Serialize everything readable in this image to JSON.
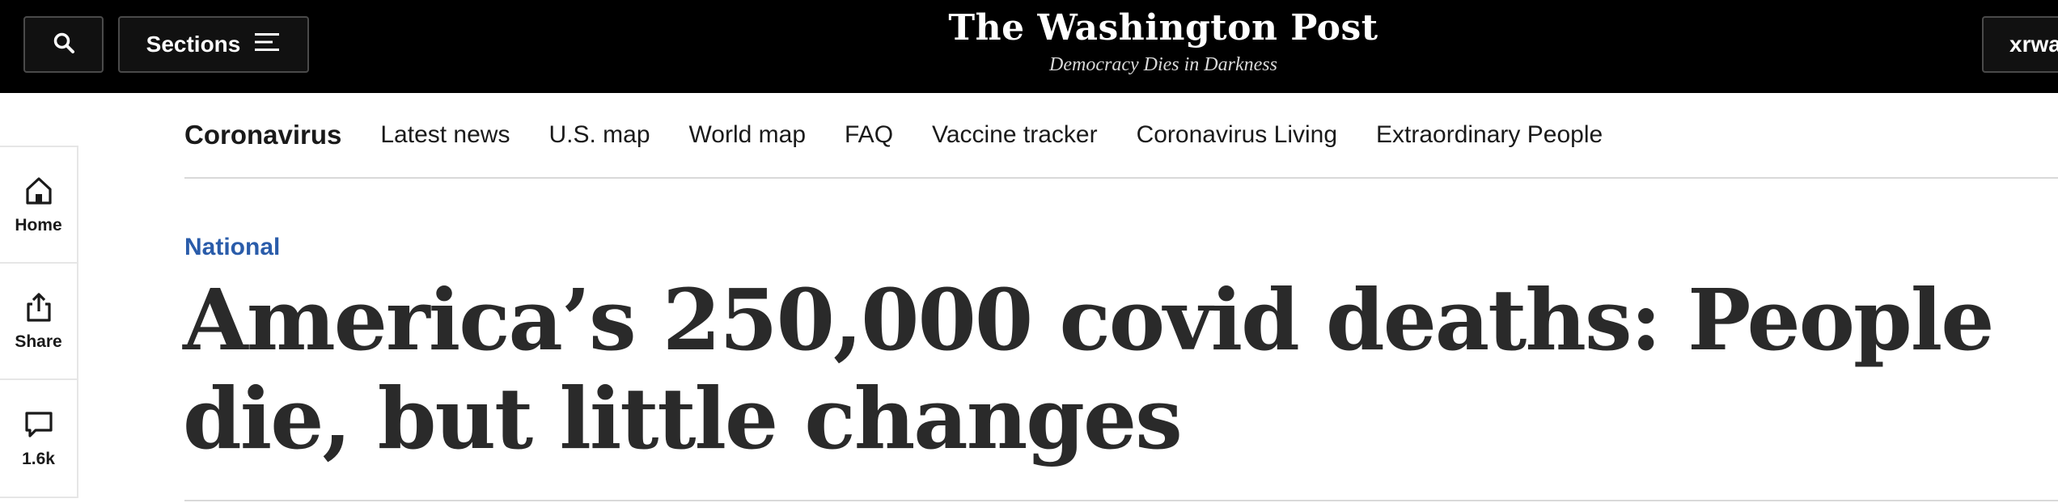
{
  "header": {
    "search_icon": "search-icon",
    "sections_label": "Sections",
    "logo": "The Washington Post",
    "tagline": "Democracy Dies in Darkness",
    "user_label": "xrwa"
  },
  "section_nav": {
    "title": "Coronavirus",
    "items": [
      "Latest news",
      "U.S. map",
      "World map",
      "FAQ",
      "Vaccine tracker",
      "Coronavirus Living",
      "Extraordinary People"
    ]
  },
  "share_rail": {
    "home_label": "Home",
    "share_label": "Share",
    "comments_label": "1.6k"
  },
  "article": {
    "kicker": "National",
    "headline": "America’s 250,000 covid deaths: People die, but little changes"
  },
  "colors": {
    "header_bg": "#000000",
    "kicker": "#2a5caa",
    "headline": "#2a2a2a"
  }
}
